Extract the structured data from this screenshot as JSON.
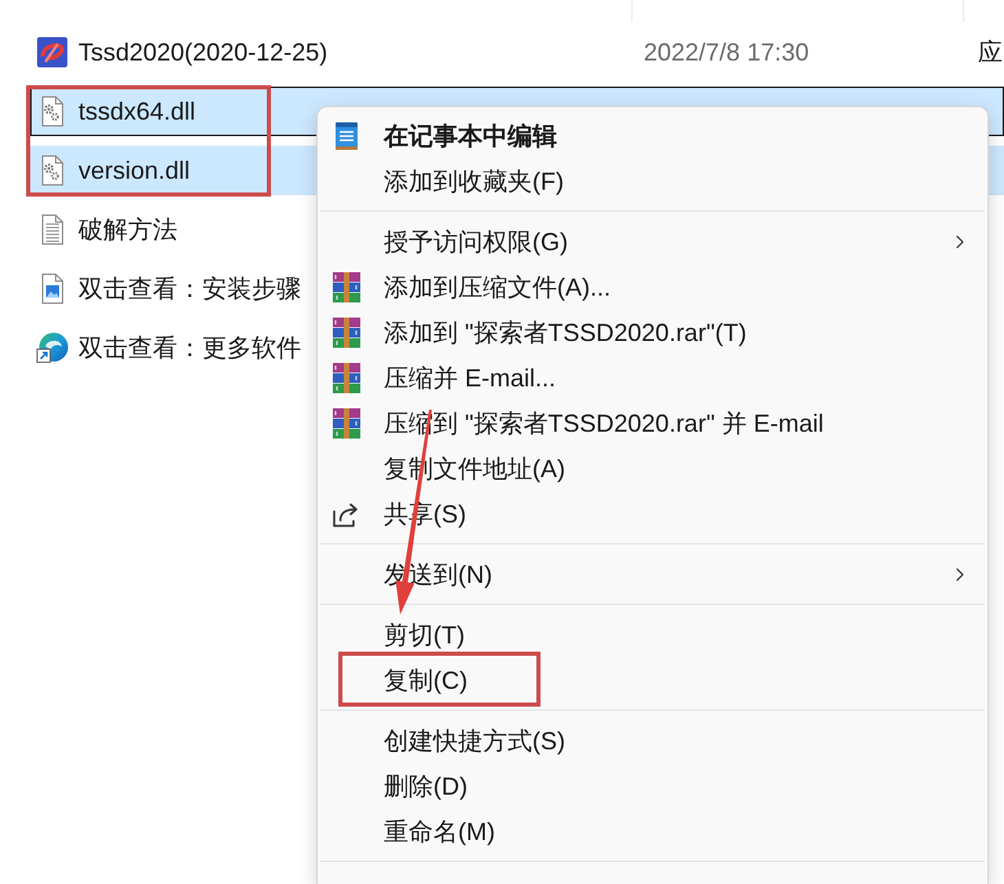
{
  "files": [
    {
      "name": "Tssd2020(2020-12-25)",
      "kind": "app",
      "date": "2022/7/8 17:30",
      "type": "应",
      "selected": false,
      "focused": false,
      "annotated": false
    },
    {
      "name": "tssdx64.dll",
      "kind": "dll",
      "selected": true,
      "focused": true,
      "annotated": true
    },
    {
      "name": "version.dll",
      "kind": "dll",
      "selected": true,
      "focused": false,
      "annotated": true
    },
    {
      "name": "破解方法",
      "kind": "text",
      "selected": false,
      "focused": false,
      "annotated": false
    },
    {
      "name": "双击查看：安装步骤",
      "kind": "image",
      "selected": false,
      "focused": false,
      "annotated": false
    },
    {
      "name": "双击查看：更多软件",
      "kind": "shortcut",
      "selected": false,
      "focused": false,
      "annotated": false
    }
  ],
  "context_menu": {
    "groups": [
      {
        "items": [
          {
            "label": "在记事本中编辑",
            "kind": "notepad",
            "default": true,
            "submenu": false,
            "annotated": false
          },
          {
            "label": "添加到收藏夹(F)",
            "kind": "plain",
            "default": false,
            "submenu": false,
            "annotated": false
          }
        ]
      },
      {
        "items": [
          {
            "label": "授予访问权限(G)",
            "kind": "plain",
            "default": false,
            "submenu": true,
            "annotated": false
          },
          {
            "label": "添加到压缩文件(A)...",
            "kind": "archive",
            "default": false,
            "submenu": false,
            "annotated": false
          },
          {
            "label": "添加到 \"探索者TSSD2020.rar\"(T)",
            "kind": "archive",
            "default": false,
            "submenu": false,
            "annotated": false
          },
          {
            "label": "压缩并 E-mail...",
            "kind": "archive",
            "default": false,
            "submenu": false,
            "annotated": false
          },
          {
            "label": "压缩到 \"探索者TSSD2020.rar\" 并 E-mail",
            "kind": "archive",
            "default": false,
            "submenu": false,
            "annotated": false
          },
          {
            "label": "复制文件地址(A)",
            "kind": "plain",
            "default": false,
            "submenu": false,
            "annotated": false
          },
          {
            "label": "共享(S)",
            "kind": "share",
            "default": false,
            "submenu": false,
            "annotated": false
          }
        ]
      },
      {
        "items": [
          {
            "label": "发送到(N)",
            "kind": "plain",
            "default": false,
            "submenu": true,
            "annotated": false
          }
        ]
      },
      {
        "items": [
          {
            "label": "剪切(T)",
            "kind": "plain",
            "default": false,
            "submenu": false,
            "annotated": false
          },
          {
            "label": "复制(C)",
            "kind": "plain",
            "default": false,
            "submenu": false,
            "annotated": true
          }
        ]
      },
      {
        "items": [
          {
            "label": "创建快捷方式(S)",
            "kind": "plain",
            "default": false,
            "submenu": false,
            "annotated": false
          },
          {
            "label": "删除(D)",
            "kind": "plain",
            "default": false,
            "submenu": false,
            "annotated": false
          },
          {
            "label": "重命名(M)",
            "kind": "plain",
            "default": false,
            "submenu": false,
            "annotated": false
          }
        ]
      }
    ]
  }
}
